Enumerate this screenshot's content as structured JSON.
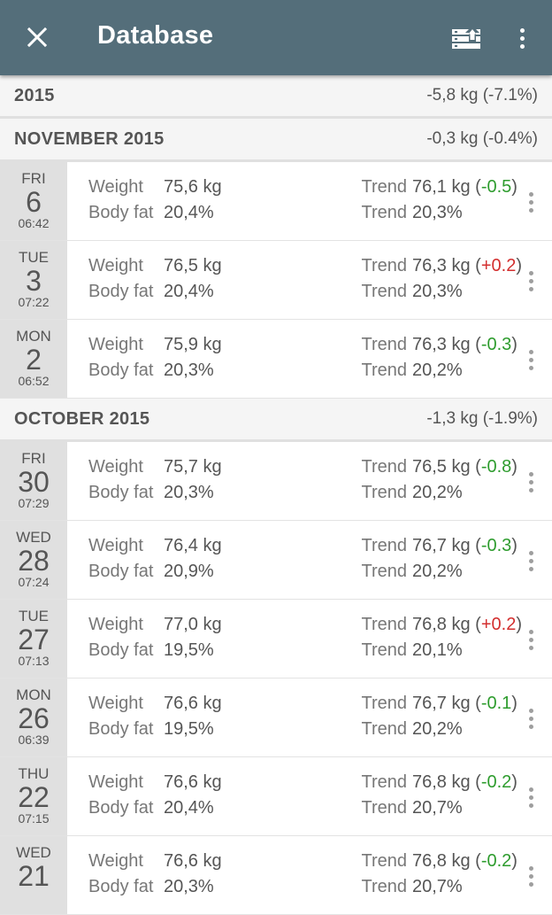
{
  "appbar": {
    "title": "Database",
    "close_icon": "close-icon",
    "export_icon": "export-icon",
    "menu_icon": "more-vert-icon",
    "color": "#546e7a"
  },
  "colors": {
    "decrease": "#2e9c2e",
    "increase": "#d32f2f"
  },
  "year_header": {
    "title": "2015",
    "change": "-5,8 kg (-7.1%)"
  },
  "sections": [
    {
      "title": "NOVEMBER 2015",
      "change": "-0,3 kg (-0.4%)",
      "entries": [
        {
          "dow": "FRI",
          "day": "6",
          "time": "06:42",
          "weight_label": "Weight",
          "weight": "75,6 kg",
          "fat_label": "Body fat",
          "fat": "20,4%",
          "trend_label": "Trend",
          "trend_weight": "76,1 kg",
          "trend_change": "-0.5",
          "trend_dir": "neg",
          "trend_fat": "20,3%"
        },
        {
          "dow": "TUE",
          "day": "3",
          "time": "07:22",
          "weight_label": "Weight",
          "weight": "76,5 kg",
          "fat_label": "Body fat",
          "fat": "20,4%",
          "trend_label": "Trend",
          "trend_weight": "76,3 kg",
          "trend_change": "+0.2",
          "trend_dir": "pos",
          "trend_fat": "20,3%"
        },
        {
          "dow": "MON",
          "day": "2",
          "time": "06:52",
          "weight_label": "Weight",
          "weight": "75,9 kg",
          "fat_label": "Body fat",
          "fat": "20,3%",
          "trend_label": "Trend",
          "trend_weight": "76,3 kg",
          "trend_change": "-0.3",
          "trend_dir": "neg",
          "trend_fat": "20,2%"
        }
      ]
    },
    {
      "title": "OCTOBER 2015",
      "change": "-1,3 kg (-1.9%)",
      "entries": [
        {
          "dow": "FRI",
          "day": "30",
          "time": "07:29",
          "weight_label": "Weight",
          "weight": "75,7 kg",
          "fat_label": "Body fat",
          "fat": "20,3%",
          "trend_label": "Trend",
          "trend_weight": "76,5 kg",
          "trend_change": "-0.8",
          "trend_dir": "neg",
          "trend_fat": "20,2%"
        },
        {
          "dow": "WED",
          "day": "28",
          "time": "07:24",
          "weight_label": "Weight",
          "weight": "76,4 kg",
          "fat_label": "Body fat",
          "fat": "20,9%",
          "trend_label": "Trend",
          "trend_weight": "76,7 kg",
          "trend_change": "-0.3",
          "trend_dir": "neg",
          "trend_fat": "20,2%"
        },
        {
          "dow": "TUE",
          "day": "27",
          "time": "07:13",
          "weight_label": "Weight",
          "weight": "77,0 kg",
          "fat_label": "Body fat",
          "fat": "19,5%",
          "trend_label": "Trend",
          "trend_weight": "76,8 kg",
          "trend_change": "+0.2",
          "trend_dir": "pos",
          "trend_fat": "20,1%"
        },
        {
          "dow": "MON",
          "day": "26",
          "time": "06:39",
          "weight_label": "Weight",
          "weight": "76,6 kg",
          "fat_label": "Body fat",
          "fat": "19,5%",
          "trend_label": "Trend",
          "trend_weight": "76,7 kg",
          "trend_change": "-0.1",
          "trend_dir": "neg",
          "trend_fat": "20,2%"
        },
        {
          "dow": "THU",
          "day": "22",
          "time": "07:15",
          "weight_label": "Weight",
          "weight": "76,6 kg",
          "fat_label": "Body fat",
          "fat": "20,4%",
          "trend_label": "Trend",
          "trend_weight": "76,8 kg",
          "trend_change": "-0.2",
          "trend_dir": "neg",
          "trend_fat": "20,7%"
        },
        {
          "dow": "WED",
          "day": "21",
          "time": "",
          "weight_label": "Weight",
          "weight": "76,6 kg",
          "fat_label": "Body fat",
          "fat": "20,3%",
          "trend_label": "Trend",
          "trend_weight": "76,8 kg",
          "trend_change": "-0.2",
          "trend_dir": "neg",
          "trend_fat": "20,7%"
        }
      ]
    }
  ]
}
